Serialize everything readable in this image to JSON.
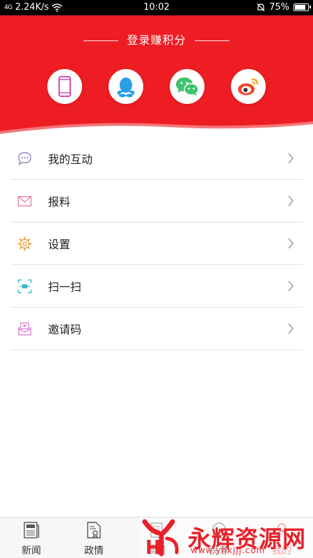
{
  "status_bar": {
    "signal": "4G",
    "speed": "2.24K/s",
    "time": "10:02",
    "battery": "75%",
    "battery_level": 0.75
  },
  "login": {
    "title": "登录赚积分",
    "methods": [
      "phone-icon",
      "qq-icon",
      "wechat-icon",
      "weibo-icon"
    ]
  },
  "menu": {
    "items": [
      {
        "label": "我的互动",
        "icon": "chat-bubble-icon",
        "color": "#8e7cc3"
      },
      {
        "label": "报料",
        "icon": "mail-icon",
        "color": "#e47f9c"
      },
      {
        "label": "设置",
        "icon": "gear-icon",
        "color": "#f0a040"
      },
      {
        "label": "扫一扫",
        "icon": "scan-icon",
        "color": "#35b7c8"
      },
      {
        "label": "邀请码",
        "icon": "invite-envelope-icon",
        "color": "#d77ad0"
      }
    ]
  },
  "tabbar": {
    "tabs": [
      {
        "label": "新闻"
      },
      {
        "label": "政情"
      },
      {
        "label": "读报"
      },
      {
        "label": "民意"
      },
      {
        "label": "我的"
      }
    ]
  },
  "watermark": {
    "title": "永辉资源网",
    "url": "www.yhkjjj.com"
  },
  "colors": {
    "brand_red": "#ee1d23",
    "divider": "#e3e3e3"
  }
}
